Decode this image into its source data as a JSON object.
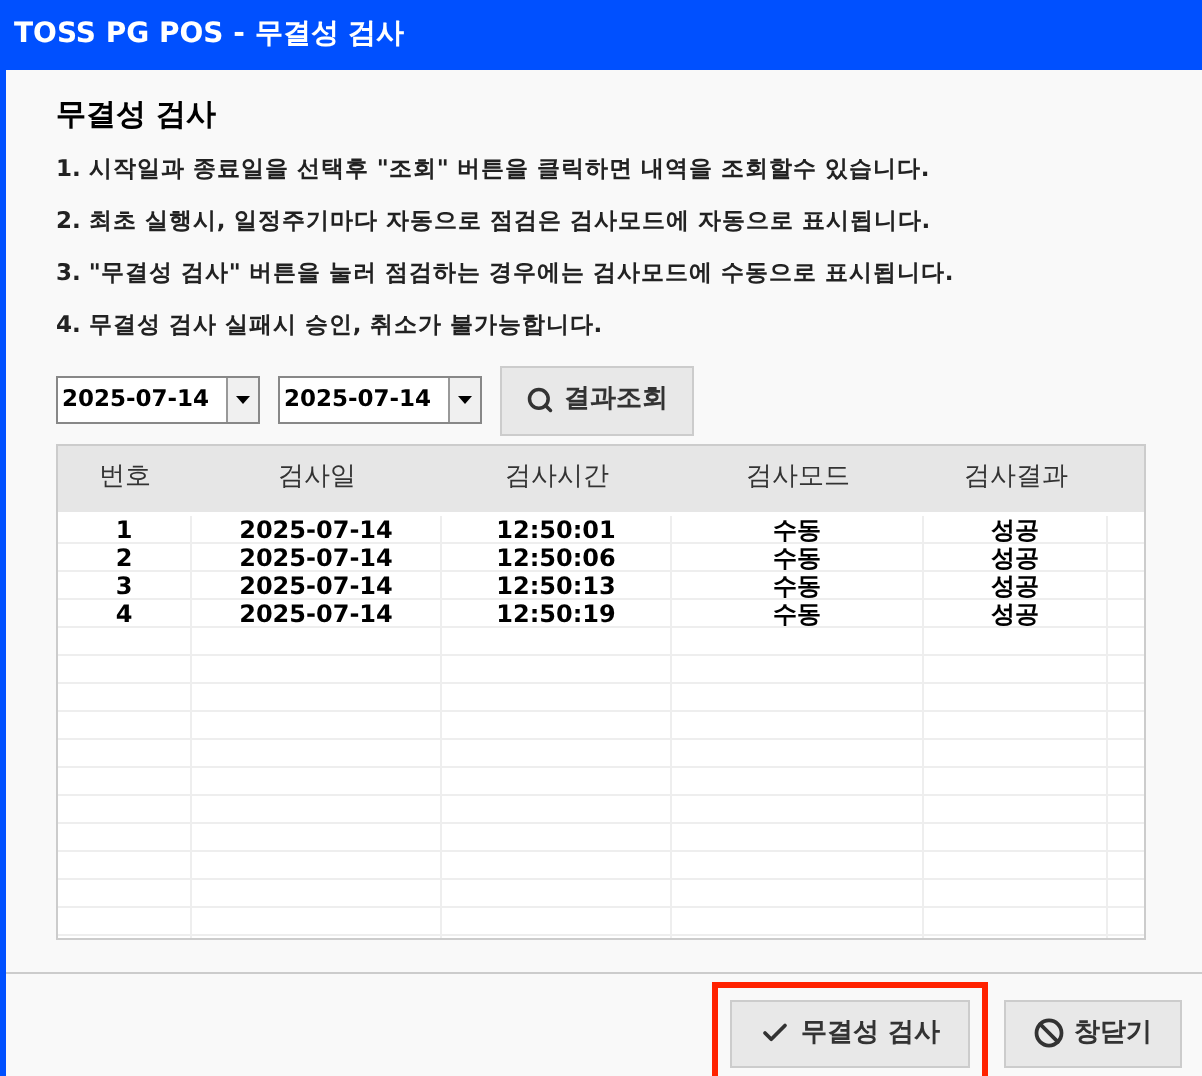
{
  "window": {
    "title": "TOSS PG POS - 무결성 검사"
  },
  "heading": "무결성 검사",
  "instructions": [
    "1. 시작일과 종료일을 선택후 \"조회\" 버튼을 클릭하면 내역을 조회할수 있습니다.",
    "2. 최초 실행시, 일정주기마다 자동으로 점검은 검사모드에 자동으로 표시됩니다.",
    "3. \"무결성 검사\" 버튼을 눌러 점검하는 경우에는 검사모드에 수동으로 표시됩니다.",
    "4. 무결성 검사 실패시 승인, 취소가 불가능합니다."
  ],
  "start_date": "2025-07-14",
  "end_date": "2025-07-14",
  "search_button": "결과조회",
  "table": {
    "columns": [
      "번호",
      "검사일",
      "검사시간",
      "검사모드",
      "검사결과"
    ],
    "rows": [
      [
        "1",
        "2025-07-14",
        "12:50:01",
        "수동",
        "성공"
      ],
      [
        "2",
        "2025-07-14",
        "12:50:06",
        "수동",
        "성공"
      ],
      [
        "3",
        "2025-07-14",
        "12:50:13",
        "수동",
        "성공"
      ],
      [
        "4",
        "2025-07-14",
        "12:50:19",
        "수동",
        "성공"
      ]
    ]
  },
  "buttons": [
    {
      "label": "무결성 검사",
      "kind": "check",
      "highlighted": true
    },
    {
      "label": "창닫기",
      "kind": "close",
      "highlighted": false
    }
  ]
}
